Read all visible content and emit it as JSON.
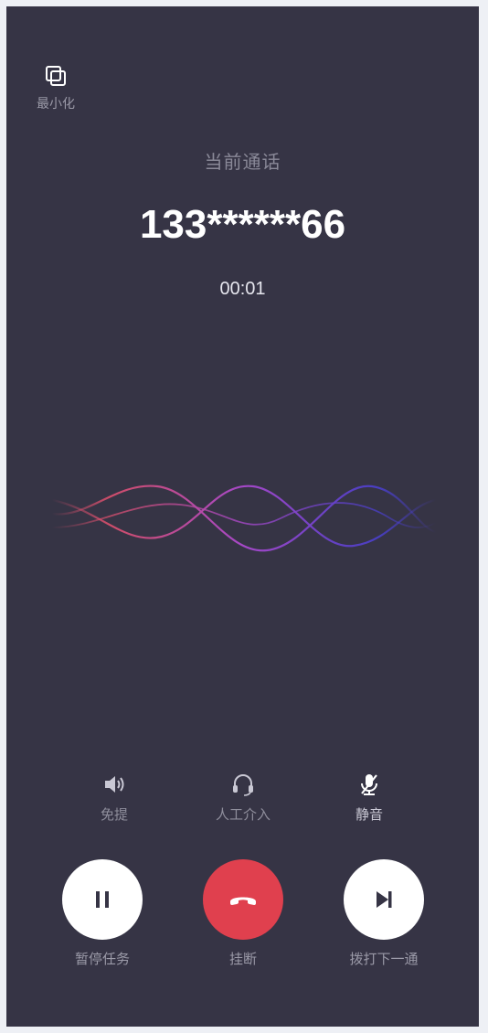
{
  "minimize": {
    "label": "最小化",
    "icon": "minimize-icon"
  },
  "call": {
    "title": "当前通话",
    "number": "133******66",
    "duration": "00:01"
  },
  "controls": {
    "speaker": {
      "label": "免提",
      "icon": "speaker-icon"
    },
    "manual": {
      "label": "人工介入",
      "icon": "headset-icon"
    },
    "mute": {
      "label": "静音",
      "icon": "mic-off-icon"
    }
  },
  "actions": {
    "pause": {
      "label": "暂停任务",
      "icon": "pause-icon"
    },
    "hangup": {
      "label": "挂断",
      "icon": "hangup-icon"
    },
    "next": {
      "label": "拨打下一通",
      "icon": "skip-next-icon"
    }
  },
  "colors": {
    "background": "#363445",
    "hangup": "#e0404e",
    "wave_start": "#e0506e",
    "wave_end": "#4a3fcf"
  }
}
